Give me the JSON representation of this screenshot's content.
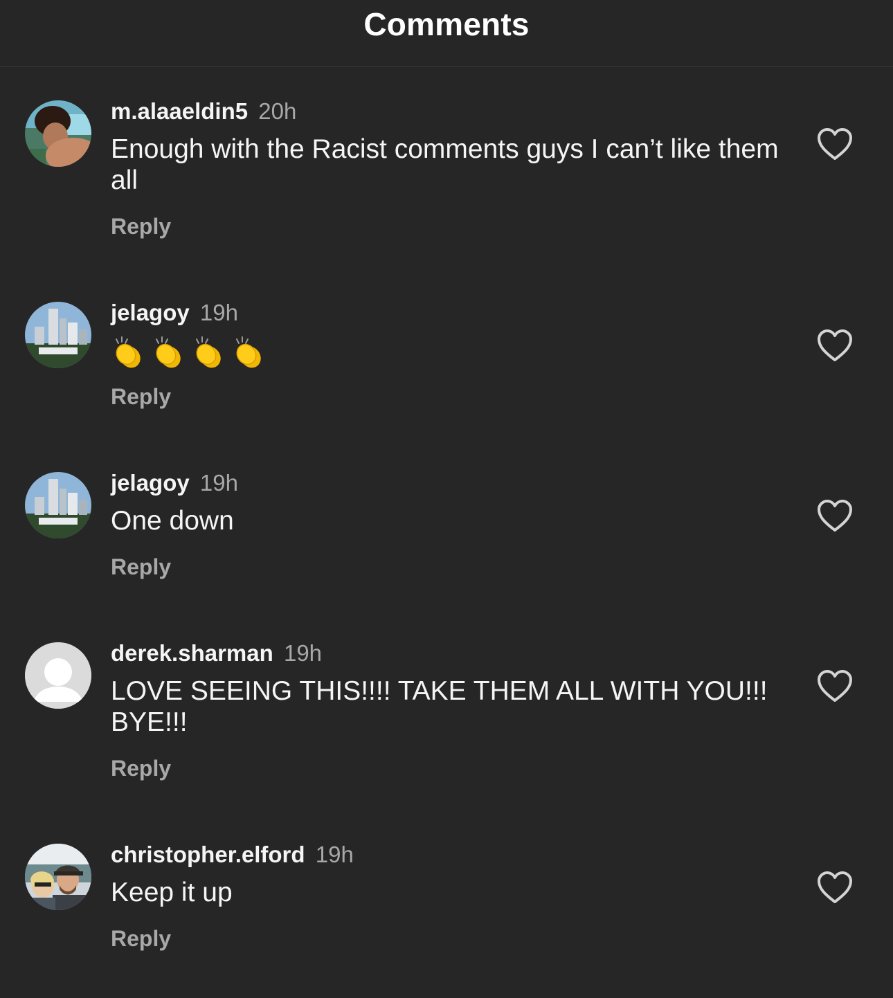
{
  "header": {
    "title": "Comments"
  },
  "icons": {
    "like": "heart-outline-icon",
    "clap": "clapping-hands-icon"
  },
  "comments": [
    {
      "username": "m.alaaeldin5",
      "time": "20h",
      "text": "Enough with the Racist comments guys I can’t like them all",
      "reply_label": "Reply",
      "avatar": "profile-photo"
    },
    {
      "username": "jelagoy",
      "time": "19h",
      "text": "👏👏👏👏",
      "reply_label": "Reply",
      "avatar": "city-skyline-photo"
    },
    {
      "username": "jelagoy",
      "time": "19h",
      "text": "One down",
      "reply_label": "Reply",
      "avatar": "city-skyline-photo"
    },
    {
      "username": "derek.sharman",
      "time": "19h",
      "text": "LOVE SEEING THIS!!!! TAKE THEM ALL WITH YOU!!! BYE!!!",
      "reply_label": "Reply",
      "avatar": "default-avatar"
    },
    {
      "username": "christopher.elford",
      "time": "19h",
      "text": "Keep it up",
      "reply_label": "Reply",
      "avatar": "couple-photo"
    }
  ]
}
